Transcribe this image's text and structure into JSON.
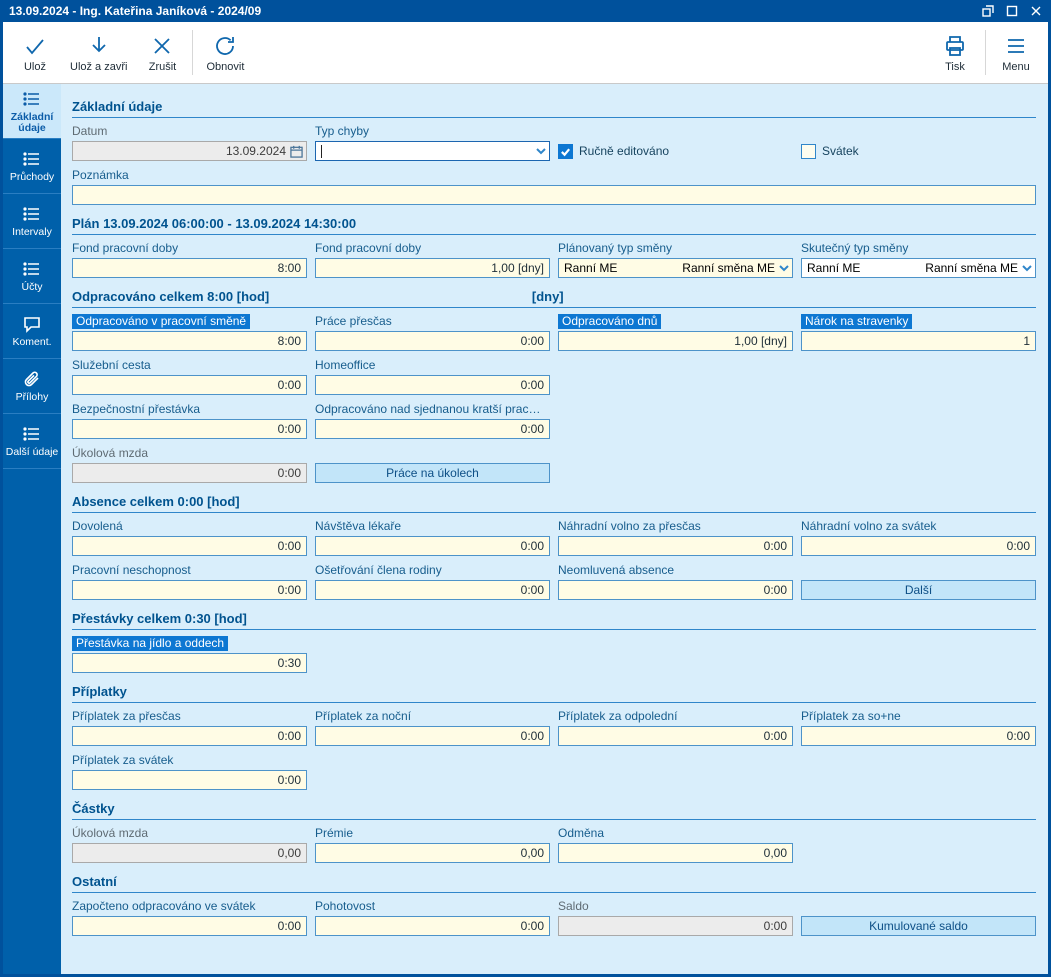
{
  "window": {
    "title": "13.09.2024 - Ing. Kateřina Janíková - 2024/09"
  },
  "toolbar": {
    "save": "Ulož",
    "save_close": "Ulož a zavři",
    "cancel": "Zrušit",
    "refresh": "Obnovit",
    "print": "Tisk",
    "menu": "Menu"
  },
  "sidebar": {
    "items": [
      {
        "label": "Základní údaje",
        "active": true
      },
      {
        "label": "Průchody",
        "active": false
      },
      {
        "label": "Intervaly",
        "active": false
      },
      {
        "label": "Účty",
        "active": false
      },
      {
        "label": "Koment.",
        "active": false
      },
      {
        "label": "Přílohy",
        "active": false
      },
      {
        "label": "Další údaje",
        "active": false
      }
    ]
  },
  "basic": {
    "heading": "Základní údaje",
    "datum": {
      "label": "Datum",
      "value": "13.09.2024"
    },
    "typ_chyby": {
      "label": "Typ chyby",
      "value": ""
    },
    "rucne_editovano": {
      "label": "Ručně editováno",
      "checked": true
    },
    "svatek": {
      "label": "Svátek",
      "checked": false
    },
    "poznamka": {
      "label": "Poznámka",
      "value": ""
    }
  },
  "plan": {
    "heading": "Plán 13.09.2024 06:00:00 - 13.09.2024 14:30:00",
    "fond1": {
      "label": "Fond pracovní doby",
      "value": "8:00"
    },
    "fond2": {
      "label": "Fond pracovní doby",
      "value": "1,00 [dny]"
    },
    "plan_smena": {
      "label": "Plánovaný typ směny",
      "code": "Ranní ME",
      "name": "Ranní směna ME"
    },
    "skut_smena": {
      "label": "Skutečný typ směny",
      "code": "Ranní ME",
      "name": "Ranní směna ME"
    }
  },
  "worked": {
    "heading": "Odpracováno celkem 8:00 [hod]",
    "heading_right": "[dny]",
    "odprac_smena": {
      "label": "Odpracováno v pracovní směně",
      "value": "8:00"
    },
    "prace_prescas": {
      "label": "Práce přesčas",
      "value": "0:00"
    },
    "odprac_dnu": {
      "label": "Odpracováno dnů",
      "value": "1,00 [dny]"
    },
    "narok_stravenky": {
      "label": "Nárok na stravenky",
      "value": "1"
    },
    "sluzebni_cesta": {
      "label": "Služební cesta",
      "value": "0:00"
    },
    "homeoffice": {
      "label": "Homeoffice",
      "value": "0:00"
    },
    "bezp_prestavka": {
      "label": "Bezpečnostní přestávka",
      "value": "0:00"
    },
    "odprac_nad": {
      "label": "Odpracováno nad sjednanou kratší prac…",
      "value": "0:00"
    },
    "ukolova_mzda": {
      "label": "Úkolová mzda",
      "value": "0:00"
    },
    "prace_na_ukolech_button": "Práce na úkolech"
  },
  "absence": {
    "heading": "Absence celkem 0:00 [hod]",
    "dovolena": {
      "label": "Dovolená",
      "value": "0:00"
    },
    "navsteva_lekare": {
      "label": "Návštěva lékaře",
      "value": "0:00"
    },
    "nahradni_prescas": {
      "label": "Náhradní volno za přesčas",
      "value": "0:00"
    },
    "nahradni_svatek": {
      "label": "Náhradní volno za svátek",
      "value": "0:00"
    },
    "prac_neschopnost": {
      "label": "Pracovní neschopnost",
      "value": "0:00"
    },
    "osetrovani": {
      "label": "Ošetřování člena rodiny",
      "value": "0:00"
    },
    "neomluvena": {
      "label": "Neomluvená absence",
      "value": "0:00"
    },
    "dalsi_button": "Další"
  },
  "breaks": {
    "heading": "Přestávky celkem 0:30 [hod]",
    "jidlo": {
      "label": "Přestávka na jídlo a oddech",
      "value": "0:30"
    }
  },
  "priplatky": {
    "heading": "Příplatky",
    "prescas": {
      "label": "Příplatek za přesčas",
      "value": "0:00"
    },
    "nocni": {
      "label": "Příplatek za noční",
      "value": "0:00"
    },
    "odpoledni": {
      "label": "Příplatek za odpolední",
      "value": "0:00"
    },
    "so_ne": {
      "label": "Příplatek za so+ne",
      "value": "0:00"
    },
    "svatek": {
      "label": "Příplatek za svátek",
      "value": "0:00"
    }
  },
  "castky": {
    "heading": "Částky",
    "ukolova_mzda": {
      "label": "Úkolová mzda",
      "value": "0,00"
    },
    "premie": {
      "label": "Prémie",
      "value": "0,00"
    },
    "odmena": {
      "label": "Odměna",
      "value": "0,00"
    }
  },
  "ostatni": {
    "heading": "Ostatní",
    "zapocteno": {
      "label": "Započteno odpracováno ve svátek",
      "value": "0:00"
    },
    "pohotovost": {
      "label": "Pohotovost",
      "value": "0:00"
    },
    "saldo": {
      "label": "Saldo",
      "value": "0:00"
    },
    "kumulovane_button": "Kumulované saldo"
  }
}
